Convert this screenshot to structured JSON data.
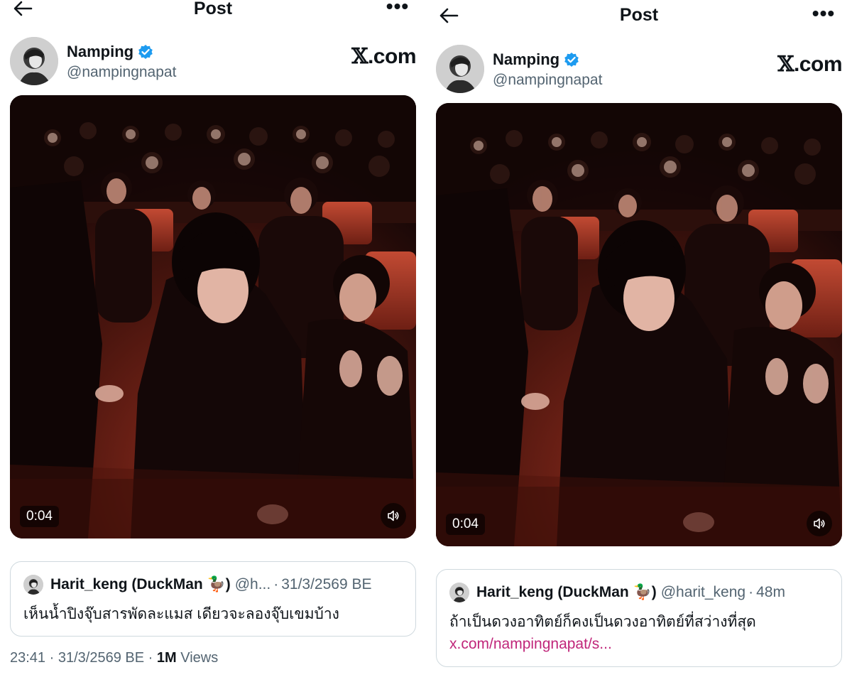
{
  "left": {
    "header": {
      "title": "Post",
      "more": "•••"
    },
    "author": {
      "name": "Namping",
      "handle": "@nampingnapat",
      "verified": true
    },
    "watermark": {
      "x": "𝕏",
      "domain": ".com"
    },
    "media": {
      "duration": "0:04"
    },
    "quote": {
      "name": "Harit_keng (DuckMan 🦆)",
      "handle": "@h...",
      "sep": "·",
      "time": "31/3/2569 BE",
      "text": "เห็นน้ำปิงจุ๊บสารพัดละแมส เดียวจะลองจุ๊บเขมบ้าง"
    },
    "meta": {
      "time": "23:41",
      "sep": "·",
      "date": "31/3/2569 BE",
      "sep2": "·",
      "views_count": "1M",
      "views_label": "Views"
    }
  },
  "right": {
    "header": {
      "title": "Post",
      "more": "•••"
    },
    "author": {
      "name": "Namping",
      "handle": "@nampingnapat",
      "verified": true
    },
    "watermark": {
      "x": "𝕏",
      "domain": ".com"
    },
    "media": {
      "duration": "0:04"
    },
    "quote": {
      "name": "Harit_keng (DuckMan 🦆)",
      "handle": "@harit_keng",
      "sep": "·",
      "time": "48m",
      "text": "ถ้าเป็นดวงอาทิตย์ก็คงเป็นดวงอาทิตย์ที่สว่างที่สุด",
      "link": "x.com/nampingnapat/s..."
    }
  },
  "colors": {
    "verified": "#1d9bf0",
    "link": "#c0267a",
    "secondary_text": "#536471",
    "border": "#cfd9de"
  }
}
